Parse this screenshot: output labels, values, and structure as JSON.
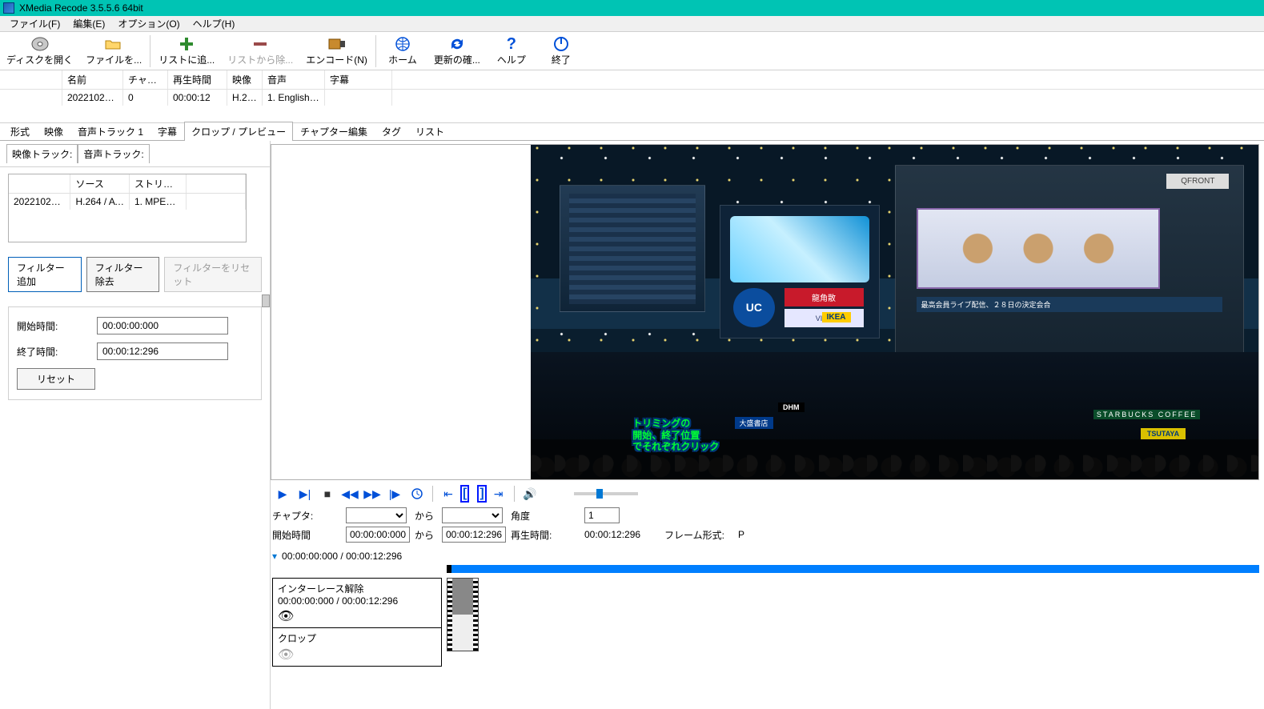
{
  "window": {
    "title": "XMedia Recode 3.5.5.6 64bit"
  },
  "menu": {
    "file": "ファイル(F)",
    "edit": "編集(E)",
    "option": "オプション(O)",
    "help": "ヘルプ(H)"
  },
  "toolbar": {
    "openDisc": "ディスクを開く",
    "openFile": "ファイルを...",
    "addList": "リストに追...",
    "removeList": "リストから除...",
    "encode": "エンコード(N)",
    "home": "ホーム",
    "update": "更新の確...",
    "help": "ヘルプ",
    "exit": "終了"
  },
  "fileList": {
    "headers": {
      "name": "名前",
      "chapter": "チャプター",
      "playtime": "再生時間",
      "video": "映像",
      "audio": "音声",
      "subtitle": "字幕"
    },
    "row": {
      "name": "20221021_...",
      "chapter": "0",
      "playtime": "00:00:12",
      "video": "H.26...",
      "audio": "1. English A...",
      "subtitle": ""
    }
  },
  "tabs": {
    "format": "形式",
    "video": "映像",
    "audio1": "音声トラック 1",
    "subtitle": "字幕",
    "cropPreview": "クロップ / プレビュー",
    "chapterEdit": "チャプター編集",
    "tag": "タグ",
    "list": "リスト"
  },
  "leftTabs": {
    "videoTrack": "映像トラック:",
    "audioTrack": "音声トラック:"
  },
  "trackTable": {
    "headers": {
      "source": "ソース",
      "stream": "ストリーム"
    },
    "row": {
      "name": "20221021_2...",
      "source": "H.264 / AV...",
      "stream": "1. MPEG-4 ..."
    }
  },
  "filterBtns": {
    "add": "フィルター追加",
    "remove": "フィルター除去",
    "reset": "フィルターをリセット"
  },
  "timePanel": {
    "startLabel": "開始時間:",
    "endLabel": "終了時間:",
    "start": "00:00:00:000",
    "end": "00:00:12:296",
    "reset": "リセット"
  },
  "overlay": {
    "l1": "トリミングの",
    "l2": "開始、終了位置",
    "l3": "でそれぞれクリック"
  },
  "player": {
    "chapterLabel": "チャプタ:",
    "fromLabel": "から",
    "startLabel": "開始時間",
    "start": "00:00:00:000",
    "end": "00:00:12:296",
    "angleLabel": "角度",
    "angleVal": "1",
    "durationLabel": "再生時間:",
    "duration": "00:00:12:296",
    "frameFmtLabel": "フレーム形式:",
    "frameFmt": "P",
    "timelineRange": "00:00:00:000 / 00:00:12:296"
  },
  "filterCards": {
    "deint": {
      "title": "インターレース解除",
      "range": "00:00:00:000 / 00:00:12:296"
    },
    "crop": {
      "title": "クロップ"
    }
  },
  "preview": {
    "uc": "UC",
    "ad_red": "龍角散",
    "ad_visa": "VISA",
    "ikea": "IKEA",
    "q109": "QFRONT",
    "ticker": "最高会員ライブ配信、２８日の決定会合",
    "starbucks": "STARBUCKS  COFFEE",
    "tsutaya": "TSUTAYA",
    "dhm": "DHM",
    "blue": "大盛書店"
  }
}
